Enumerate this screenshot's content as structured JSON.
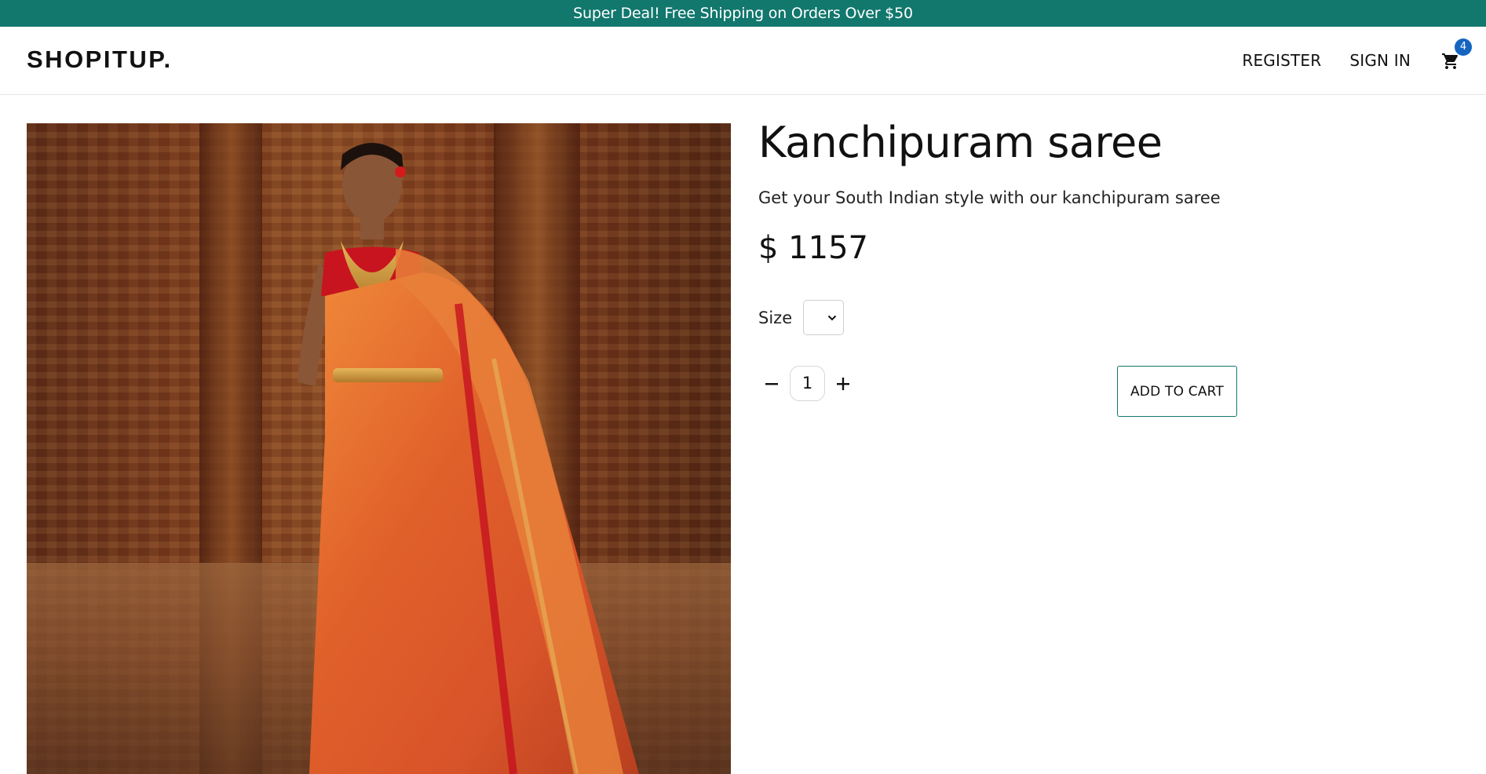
{
  "announcement": {
    "text": "Super Deal! Free Shipping on Orders Over $50",
    "background_color": "#12776d"
  },
  "header": {
    "logo": "SHOPITUP.",
    "register_label": "REGISTER",
    "signin_label": "SIGN IN",
    "cart": {
      "icon": "shopping-cart-icon",
      "count": "4",
      "badge_color": "#1565c0"
    }
  },
  "product": {
    "image_icon": "saree-product-photo",
    "title": "Kanchipuram saree",
    "description": "Get your South Indian style with our kanchipuram saree",
    "price": "$ 1157",
    "size_label": "Size",
    "size_selected": "",
    "quantity": "1",
    "decrement_icon": "minus-icon",
    "increment_icon": "plus-icon",
    "add_to_cart_label": "ADD TO CART",
    "accent_color": "#12776d"
  }
}
